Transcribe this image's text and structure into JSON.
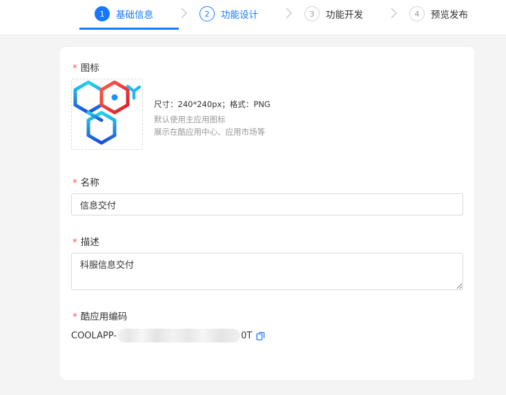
{
  "steps": [
    {
      "num": "1",
      "label": "基础信息"
    },
    {
      "num": "2",
      "label": "功能设计"
    },
    {
      "num": "3",
      "label": "功能开发"
    },
    {
      "num": "4",
      "label": "预览发布"
    }
  ],
  "form": {
    "icon": {
      "label": "图标",
      "hint_size": "尺寸：240*240px；格式：PNG",
      "hint_default": "默认使用主应用图标",
      "hint_display": "展示在酷应用中心、应用市场等"
    },
    "name": {
      "label": "名称",
      "value": "信息交付"
    },
    "description": {
      "label": "描述",
      "value": "科服信息交付"
    },
    "code": {
      "label": "酷应用编码",
      "prefix": "COOLAPP-",
      "suffix": "0T"
    },
    "required_mark": "*"
  },
  "colors": {
    "accent": "#1677ff",
    "required": "#ff4d4f",
    "background": "#f4f4f4"
  }
}
